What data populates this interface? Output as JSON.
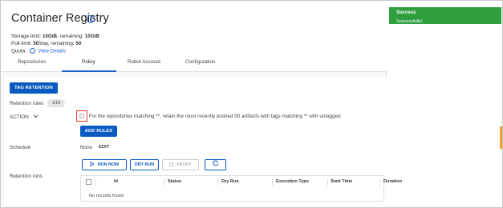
{
  "header": {
    "title": "Container Registry",
    "storage_label": "Storage-limit: ",
    "storage_limit": "10GiB",
    "storage_remaining_label": ", remaining: ",
    "storage_remaining": "10GiB",
    "pull_label": "Pull-limit: ",
    "pull_limit": "50",
    "pull_remaining_label": "/day, remaining: ",
    "pull_remaining": "50",
    "quota_label": "Quota:",
    "view_details": "View Details"
  },
  "tabs": [
    {
      "label": "Repositories"
    },
    {
      "label": "Policy",
      "active": true
    },
    {
      "label": "Robot Account"
    },
    {
      "label": "Configuration"
    }
  ],
  "policy": {
    "tag_retention_button": "TAG RETENTION",
    "retention_rules_label": "Retention rules",
    "retention_rules_count": "1/15",
    "action_label": "ACTION",
    "rule_text": "For the repositories matching **, retain the most recently pushed 50 artifacts with tags matching ** with untagged",
    "add_rules_button": "ADD RULES",
    "schedule_label": "Schedule",
    "schedule_value": "None",
    "schedule_edit": "EDIT",
    "retention_runs_label": "Retention runs",
    "run_now_button": "RUN NOW",
    "dry_run_button": "DRY RUN",
    "abort_button": "ABORT",
    "runs_table": {
      "columns": [
        "Id",
        "Status",
        "Dry Run",
        "Execution Type",
        "Start Time",
        "Duration"
      ],
      "empty_text": "No records found"
    }
  },
  "toast": {
    "title": "Success",
    "message": "Successfully!"
  },
  "colors": {
    "primary": "#0b5ac2",
    "success": "#2e9e3e",
    "highlight": "#e3342f",
    "accent": "#f29d2b"
  },
  "icons": [
    "info-icon",
    "chevron-down-icon",
    "play-icon",
    "stop-icon",
    "refresh-icon",
    "warning-icon"
  ]
}
